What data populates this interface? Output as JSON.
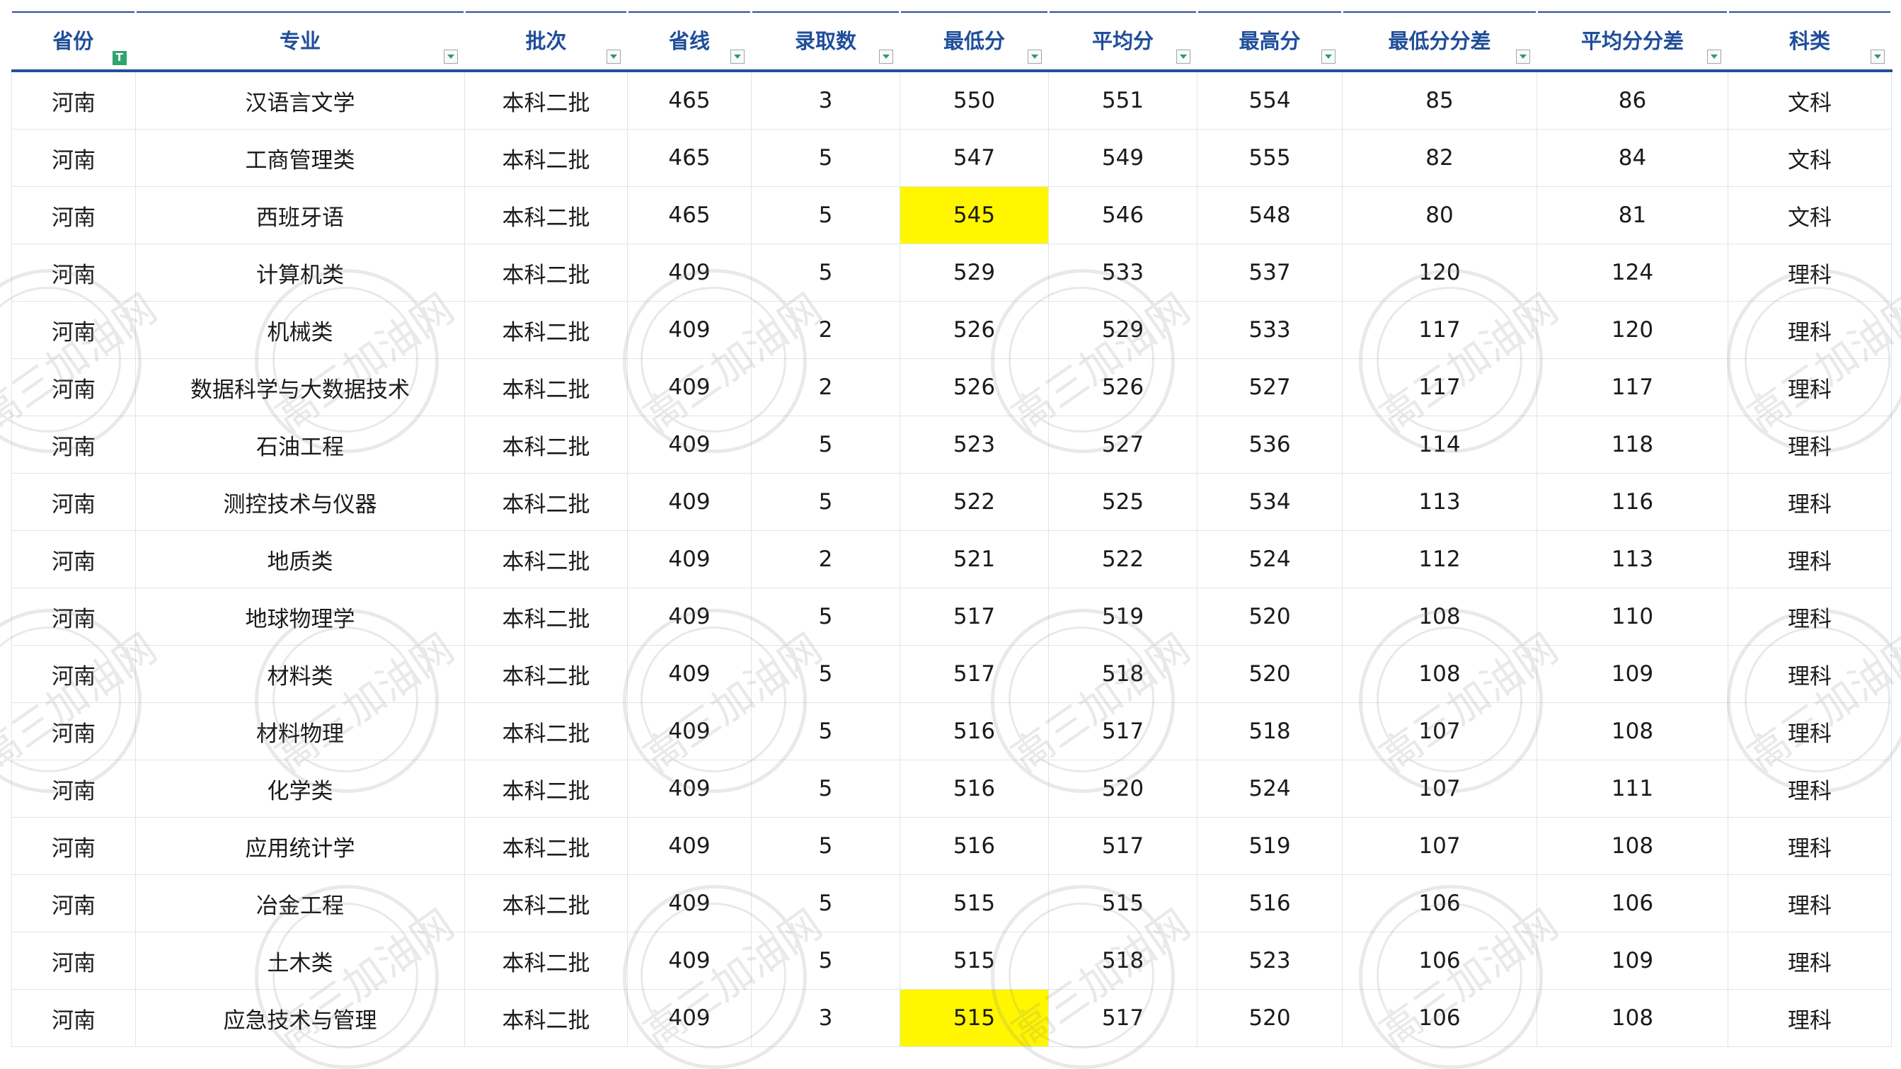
{
  "table": {
    "columns": [
      "省份",
      "专业",
      "批次",
      "省线",
      "录取数",
      "最低分",
      "平均分",
      "最高分",
      "最低分分差",
      "平均分分差",
      "科类"
    ],
    "rows": [
      [
        "河南",
        "汉语言文学",
        "本科二批",
        "465",
        "3",
        "550",
        "551",
        "554",
        "85",
        "86",
        "文科"
      ],
      [
        "河南",
        "工商管理类",
        "本科二批",
        "465",
        "5",
        "547",
        "549",
        "555",
        "82",
        "84",
        "文科"
      ],
      [
        "河南",
        "西班牙语",
        "本科二批",
        "465",
        "5",
        "545",
        "546",
        "548",
        "80",
        "81",
        "文科"
      ],
      [
        "河南",
        "计算机类",
        "本科二批",
        "409",
        "5",
        "529",
        "533",
        "537",
        "120",
        "124",
        "理科"
      ],
      [
        "河南",
        "机械类",
        "本科二批",
        "409",
        "2",
        "526",
        "529",
        "533",
        "117",
        "120",
        "理科"
      ],
      [
        "河南",
        "数据科学与大数据技术",
        "本科二批",
        "409",
        "2",
        "526",
        "526",
        "527",
        "117",
        "117",
        "理科"
      ],
      [
        "河南",
        "石油工程",
        "本科二批",
        "409",
        "5",
        "523",
        "527",
        "536",
        "114",
        "118",
        "理科"
      ],
      [
        "河南",
        "测控技术与仪器",
        "本科二批",
        "409",
        "5",
        "522",
        "525",
        "534",
        "113",
        "116",
        "理科"
      ],
      [
        "河南",
        "地质类",
        "本科二批",
        "409",
        "2",
        "521",
        "522",
        "524",
        "112",
        "113",
        "理科"
      ],
      [
        "河南",
        "地球物理学",
        "本科二批",
        "409",
        "5",
        "517",
        "519",
        "520",
        "108",
        "110",
        "理科"
      ],
      [
        "河南",
        "材料类",
        "本科二批",
        "409",
        "5",
        "517",
        "518",
        "520",
        "108",
        "109",
        "理科"
      ],
      [
        "河南",
        "材料物理",
        "本科二批",
        "409",
        "5",
        "516",
        "517",
        "518",
        "107",
        "108",
        "理科"
      ],
      [
        "河南",
        "化学类",
        "本科二批",
        "409",
        "5",
        "516",
        "520",
        "524",
        "107",
        "111",
        "理科"
      ],
      [
        "河南",
        "应用统计学",
        "本科二批",
        "409",
        "5",
        "516",
        "517",
        "519",
        "107",
        "108",
        "理科"
      ],
      [
        "河南",
        "冶金工程",
        "本科二批",
        "409",
        "5",
        "515",
        "515",
        "516",
        "106",
        "106",
        "理科"
      ],
      [
        "河南",
        "土木类",
        "本科二批",
        "409",
        "5",
        "515",
        "518",
        "523",
        "106",
        "109",
        "理科"
      ],
      [
        "河南",
        "应急技术与管理",
        "本科二批",
        "409",
        "3",
        "515",
        "517",
        "520",
        "106",
        "108",
        "理科"
      ]
    ],
    "highlighted_cells": [
      [
        2,
        5
      ],
      [
        16,
        5
      ]
    ],
    "highlight_color": "#fff600",
    "header_color": "#1f4e9a"
  },
  "watermark": {
    "text": "高三加油网"
  }
}
